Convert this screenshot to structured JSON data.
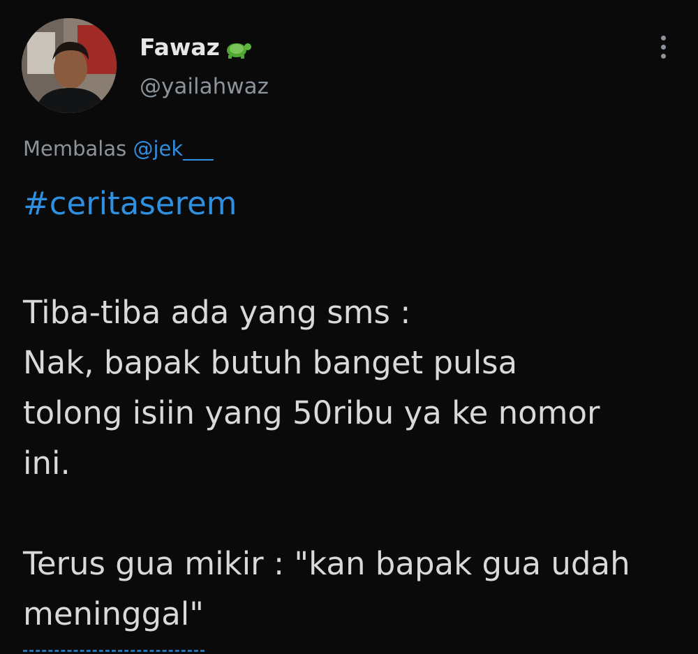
{
  "author": {
    "display_name": "Fawaz",
    "display_name_icon": "turtle-emoji-icon",
    "handle": "@yailahwaz",
    "avatar": "profile-photo"
  },
  "menu": {
    "icon": "vertical-ellipsis-icon"
  },
  "reply": {
    "prefix": "Membalas ",
    "mention": "@jek___"
  },
  "tweet": {
    "hashtag": "#ceritaserem",
    "body": "Tiba-tiba ada yang sms :\nNak, bapak butuh banget pulsa\ntolong isiin yang 50ribu ya ke nomor\nini.\n\nTerus gua mikir : \"kan bapak gua udah\nmeninggal\""
  },
  "colors": {
    "background": "#0a0a0a",
    "text": "#d9d9d9",
    "muted": "#8d939a",
    "link": "#2f8fe0"
  }
}
